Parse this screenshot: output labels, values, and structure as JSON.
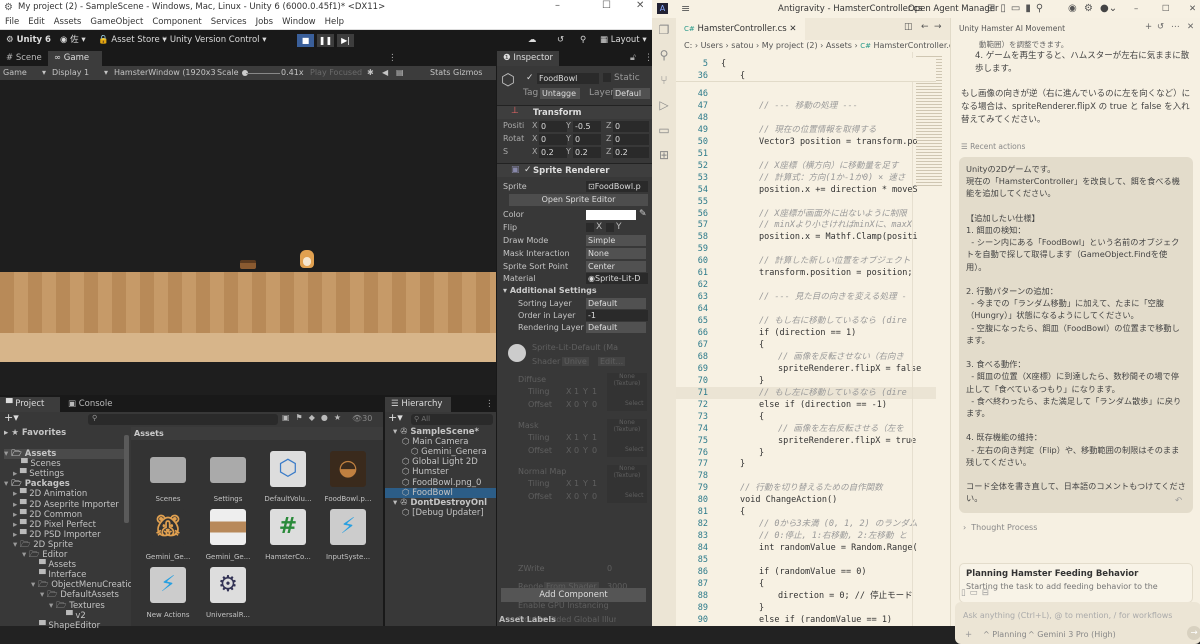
{
  "unity": {
    "title": "My project (2) - SampleScene - Windows, Mac, Linux - Unity 6 (6000.0.45f1)* <DX11>",
    "menu": [
      "File",
      "Edit",
      "Assets",
      "GameObject",
      "Component",
      "Services",
      "Jobs",
      "Window",
      "Help"
    ],
    "toolbar": {
      "unity_label": "Unity 6",
      "account": "佐",
      "asset_store": "Asset Store",
      "version_control": "Unity Version Control",
      "layout": "Layout"
    },
    "view_tabs": [
      "Scene",
      "Game"
    ],
    "game_toolbar": {
      "mode": "Game",
      "display": "Display 1",
      "resolution": "HamsterWindow (1920x3",
      "scale_label": "Scale",
      "scale_value": "0.41x",
      "play_focused": "Play Focused",
      "stats": "Stats",
      "gizmos": "Gizmos"
    },
    "inspector": {
      "tab": "Inspector",
      "object_name": "FoodBowl",
      "static": "Static",
      "tag_label": "Tag",
      "tag": "Untagge",
      "layer_label": "Layer",
      "layer": "Defaul",
      "transform": {
        "title": "Transform",
        "rows": [
          {
            "label": "Positi",
            "x": "0",
            "y": "-0.5",
            "z": "0"
          },
          {
            "label": "Rotat",
            "x": "0",
            "y": "0",
            "z": "0"
          },
          {
            "label": "S",
            "x": "0.2",
            "y": "0.2",
            "z": "0.2"
          }
        ]
      },
      "sprite_renderer": {
        "title": "Sprite Renderer",
        "sprite_label": "Sprite",
        "sprite": "FoodBowl.p",
        "open_editor": "Open Sprite Editor",
        "color_label": "Color",
        "flip_label": "Flip",
        "flip_x": "X",
        "flip_y": "Y",
        "draw_mode_label": "Draw Mode",
        "draw_mode": "Simple",
        "mask_label": "Mask Interaction",
        "mask": "None",
        "sort_label": "Sprite Sort Point",
        "sort": "Center",
        "material_label": "Material",
        "material": "Sprite-Lit-D",
        "additional": "Additional Settings",
        "sorting_layer_label": "Sorting Layer",
        "sorting_layer": "Default",
        "order_label": "Order in Layer",
        "order": "-1",
        "rendering_layer_label": "Rendering Layer M",
        "rendering_layer": "Default"
      },
      "material": {
        "name": "Sprite-Lit-Default (Ma",
        "shader_label": "Shader",
        "shader": "Unive",
        "edit": "Edit...",
        "maps": [
          {
            "name": "Diffuse",
            "tex": "None (Texture)"
          },
          {
            "name": "Mask",
            "tex": "None (Texture)"
          },
          {
            "name": "Normal Map",
            "tex": "None (Texture)"
          }
        ],
        "tiling": "Tiling",
        "offset": "Offset",
        "x": "X",
        "y": "Y",
        "one": "1",
        "zero": "0",
        "select": "Select",
        "zwrite_label": "ZWrite",
        "zwrite": "0",
        "render_label": "Render",
        "render_mode": "From Shader",
        "render_queue": "3000",
        "gpu": "Enable GPU Instancing",
        "double_sided": "Double Sided Global Illur"
      },
      "add_component": "Add Component",
      "asset_labels": "Asset Labels"
    },
    "project": {
      "tabs": [
        "Project",
        "Console"
      ],
      "hidden_count": "30",
      "favorites": "Favorites",
      "assets_header": "Assets",
      "tree": [
        {
          "label": "Assets",
          "d": 0,
          "open": true,
          "sel": true
        },
        {
          "label": "Scenes",
          "d": 1
        },
        {
          "label": "Settings",
          "d": 1,
          "arrow": true
        },
        {
          "label": "Packages",
          "d": 0,
          "open": true
        },
        {
          "label": "2D Animation",
          "d": 1,
          "arrow": true
        },
        {
          "label": "2D Aseprite Importer",
          "d": 1,
          "arrow": true
        },
        {
          "label": "2D Common",
          "d": 1,
          "arrow": true
        },
        {
          "label": "2D Pixel Perfect",
          "d": 1,
          "arrow": true
        },
        {
          "label": "2D PSD Importer",
          "d": 1,
          "arrow": true
        },
        {
          "label": "2D Sprite",
          "d": 1,
          "open": true
        },
        {
          "label": "Editor",
          "d": 2,
          "open": true
        },
        {
          "label": "Assets",
          "d": 3
        },
        {
          "label": "Interface",
          "d": 3
        },
        {
          "label": "ObjectMenuCreation",
          "d": 3,
          "open": true
        },
        {
          "label": "DefaultAssets",
          "d": 4,
          "open": true
        },
        {
          "label": "Textures",
          "d": 5,
          "open": true
        },
        {
          "label": "v2",
          "d": 6
        },
        {
          "label": "ShapeEditor",
          "d": 3
        }
      ],
      "assets": [
        {
          "label": "Scenes",
          "kind": "folder"
        },
        {
          "label": "Settings",
          "kind": "folder"
        },
        {
          "label": "DefaultVolu...",
          "kind": "volume"
        },
        {
          "label": "FoodBowl.p...",
          "kind": "bowl"
        },
        {
          "label": "Gemini_Ge...",
          "kind": "hamster"
        },
        {
          "label": "Gemini_Ge...",
          "kind": "wood"
        },
        {
          "label": "HamsterCo...",
          "kind": "script"
        },
        {
          "label": "InputSyste...",
          "kind": "input"
        },
        {
          "label": "New Actions",
          "kind": "input"
        },
        {
          "label": "UniversalR...",
          "kind": "urp"
        }
      ]
    },
    "hierarchy": {
      "tab": "Hierarchy",
      "search": "All",
      "items": [
        {
          "label": "SampleScene*",
          "d": 0,
          "scene": true
        },
        {
          "label": "Main Camera",
          "d": 1
        },
        {
          "label": "Gemini_Genera",
          "d": 2
        },
        {
          "label": "Global Light 2D",
          "d": 1
        },
        {
          "label": "Humster",
          "d": 1
        },
        {
          "label": "FoodBowl.png_0",
          "d": 1
        },
        {
          "label": "FoodBowl",
          "d": 1,
          "sel": true
        },
        {
          "label": "DontDestroyOnl",
          "d": 0,
          "scene": true
        },
        {
          "label": "[Debug Updater]",
          "d": 1
        }
      ]
    }
  },
  "antigravity": {
    "title": "Antigravity - HamsterController.cs",
    "agent_manager": "Open Agent Manager",
    "tab": "HamsterController.cs",
    "breadcrumb": [
      "C:",
      "Users",
      "satou",
      "My project (2)",
      "Assets",
      "HamsterController.cs"
    ],
    "code": [
      {
        "n": "5",
        "i": 0,
        "t": "{",
        "k": "k"
      },
      {
        "n": "36",
        "i": 1,
        "t": "{",
        "k": "k"
      },
      {
        "n": "46",
        "i": 2,
        "t": "",
        "k": "k"
      },
      {
        "n": "47",
        "i": 2,
        "t": "// --- 移動の処理 ---",
        "k": "c"
      },
      {
        "n": "48",
        "i": 2,
        "t": "",
        "k": "k"
      },
      {
        "n": "49",
        "i": 2,
        "t": "// 現在の位置情報を取得する",
        "k": "c"
      },
      {
        "n": "50",
        "i": 2,
        "t": "Vector3 position = transform.po",
        "k": "k"
      },
      {
        "n": "51",
        "i": 2,
        "t": "",
        "k": "k"
      },
      {
        "n": "52",
        "i": 2,
        "t": "// X座標（横方向）に移動量を足す",
        "k": "c"
      },
      {
        "n": "53",
        "i": 2,
        "t": "// 計算式：方向(1か-1か0) × 速さ",
        "k": "c"
      },
      {
        "n": "54",
        "i": 2,
        "t": "position.x += direction * moveS",
        "k": "k"
      },
      {
        "n": "55",
        "i": 2,
        "t": "",
        "k": "k"
      },
      {
        "n": "56",
        "i": 2,
        "t": "// X座標が画面外に出ないように制限",
        "k": "c"
      },
      {
        "n": "57",
        "i": 2,
        "t": "// minXより小さければminXに、maxX",
        "k": "c"
      },
      {
        "n": "58",
        "i": 2,
        "t": "position.x = Mathf.Clamp(positi",
        "k": "k"
      },
      {
        "n": "59",
        "i": 2,
        "t": "",
        "k": "k"
      },
      {
        "n": "60",
        "i": 2,
        "t": "// 計算した新しい位置をオブジェクト",
        "k": "c"
      },
      {
        "n": "61",
        "i": 2,
        "t": "transform.position = position;",
        "k": "k"
      },
      {
        "n": "62",
        "i": 2,
        "t": "",
        "k": "k"
      },
      {
        "n": "63",
        "i": 2,
        "t": "// --- 見た目の向きを変える処理 -",
        "k": "c"
      },
      {
        "n": "64",
        "i": 2,
        "t": "",
        "k": "k"
      },
      {
        "n": "65",
        "i": 2,
        "t": "// もし右に移動しているなら (dire",
        "k": "c"
      },
      {
        "n": "66",
        "i": 2,
        "t": "if (direction == 1)",
        "k": "k"
      },
      {
        "n": "67",
        "i": 2,
        "t": "{",
        "k": "k"
      },
      {
        "n": "68",
        "i": 3,
        "t": "// 画像を反転させない（右向き",
        "k": "c"
      },
      {
        "n": "69",
        "i": 3,
        "t": "spriteRenderer.flipX = false",
        "k": "k"
      },
      {
        "n": "70",
        "i": 2,
        "t": "}",
        "k": "k"
      },
      {
        "n": "71",
        "i": 2,
        "t": "// もし左に移動しているなら (dire",
        "k": "c",
        "hl": true
      },
      {
        "n": "72",
        "i": 2,
        "t": "else if (direction == -1)",
        "k": "k"
      },
      {
        "n": "73",
        "i": 2,
        "t": "{",
        "k": "k"
      },
      {
        "n": "74",
        "i": 3,
        "t": "// 画像を左右反転させる（左を",
        "k": "c"
      },
      {
        "n": "75",
        "i": 3,
        "t": "spriteRenderer.flipX = true",
        "k": "k"
      },
      {
        "n": "76",
        "i": 2,
        "t": "}",
        "k": "k"
      },
      {
        "n": "77",
        "i": 1,
        "t": "}",
        "k": "k"
      },
      {
        "n": "78",
        "i": 1,
        "t": "",
        "k": "k"
      },
      {
        "n": "79",
        "i": 1,
        "t": "// 行動を切り替えるための自作関数",
        "k": "c"
      },
      {
        "n": "80",
        "i": 1,
        "t": "void ChangeAction()",
        "k": "k"
      },
      {
        "n": "81",
        "i": 1,
        "t": "{",
        "k": "k"
      },
      {
        "n": "82",
        "i": 2,
        "t": "// 0から3未満 (0, 1, 2) のランダム",
        "k": "c"
      },
      {
        "n": "83",
        "i": 2,
        "t": "// 0:停止, 1:右移動, 2:左移動 と",
        "k": "c"
      },
      {
        "n": "84",
        "i": 2,
        "t": "int randomValue = Random.Range(",
        "k": "k"
      },
      {
        "n": "85",
        "i": 2,
        "t": "",
        "k": "k"
      },
      {
        "n": "86",
        "i": 2,
        "t": "if (randomValue == 0)",
        "k": "k"
      },
      {
        "n": "87",
        "i": 2,
        "t": "{",
        "k": "k"
      },
      {
        "n": "88",
        "i": 3,
        "t": "direction = 0; // 停止モード",
        "k": "k"
      },
      {
        "n": "89",
        "i": 2,
        "t": "}",
        "k": "k"
      },
      {
        "n": "90",
        "i": 2,
        "t": "else if (randomValue == 1)",
        "k": "k"
      },
      {
        "n": "91",
        "i": 2,
        "t": "{",
        "k": "k"
      }
    ],
    "chat": {
      "title": "Unity Hamster AI Movement",
      "prev_top": "動範囲）を調整できます。",
      "prev_item": "4. ゲームを再生すると、ハムスターが左右に気ままに散歩します。",
      "prev_note": "もし画像の向きが逆（右に進んでいるのに左を向くなど）になる場合は、spriteRenderer.flipX の true と false を入れ替えてみてください。",
      "recent_actions": "Recent actions",
      "user_message": "Unityの2Dゲームです。\n現在の「HamsterController」を改良して、餌を食べる機能を追加してください。\n\n【追加したい仕様】\n1. 餌皿の検知：\n  - シーン内にある「FoodBowl」という名前のオブジェクトを自動で探して取得します（GameObject.Findを使用）。\n\n2. 行動パターンの追加：\n  - 今までの「ランダム移動」に加えて、たまに「空腹（Hungry）」状態になるようにしてください。\n  - 空腹になったら、餌皿（FoodBowl）の位置まで移動します。\n\n3. 食べる動作：\n  - 餌皿の位置（X座標）に到達したら、数秒間その場で停止して「食べているつもり」になります。\n  - 食べ終わったら、また満足して「ランダム散歩」に戻ります。\n\n4. 既存機能の維持：\n  - 左右の向き判定（Flip）や、移動範囲の制限はそのまま残してください。\n\nコード全体を書き直して、日本語のコメントもつけてください。",
      "thought_process": "Thought Process",
      "plan_title": "Planning Hamster Feeding Behavior",
      "plan_text": "Starting the task to add feeding behavior to the",
      "input_placeholder": "Ask anything (Ctrl+L), @ to mention, / for workflows",
      "mode": "Planning",
      "model": "Gemini 3 Pro (High)"
    }
  }
}
